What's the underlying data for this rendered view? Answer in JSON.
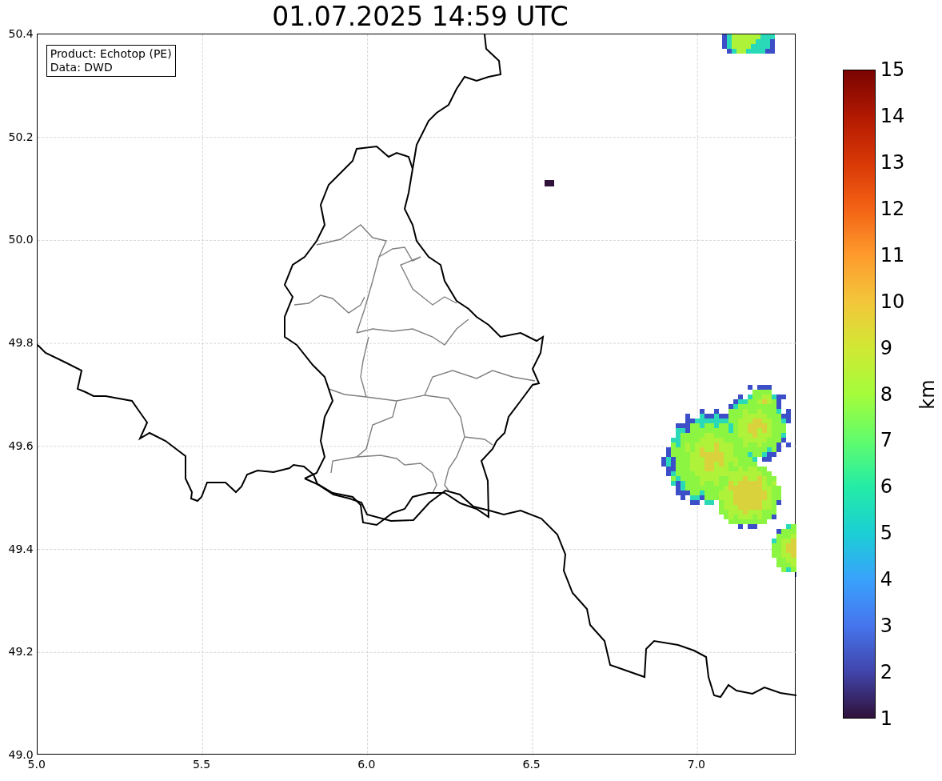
{
  "title": "01.07.2025 14:59 UTC",
  "info_box": [
    "Product: Echotop (PE)",
    "Data: DWD"
  ],
  "y_axis": {
    "ticks": [
      "50.4",
      "50.2",
      "50.0",
      "49.8",
      "49.6",
      "49.4",
      "49.2",
      "49.0"
    ]
  },
  "x_axis": {
    "ticks": [
      "5.0",
      "5.5",
      "6.0",
      "6.5",
      "7.0"
    ]
  },
  "colorbar": {
    "label": "km",
    "ticks": [
      "15",
      "14",
      "13",
      "12",
      "11",
      "10",
      "9",
      "8",
      "7",
      "6",
      "5",
      "4",
      "3",
      "2",
      "1"
    ]
  }
}
